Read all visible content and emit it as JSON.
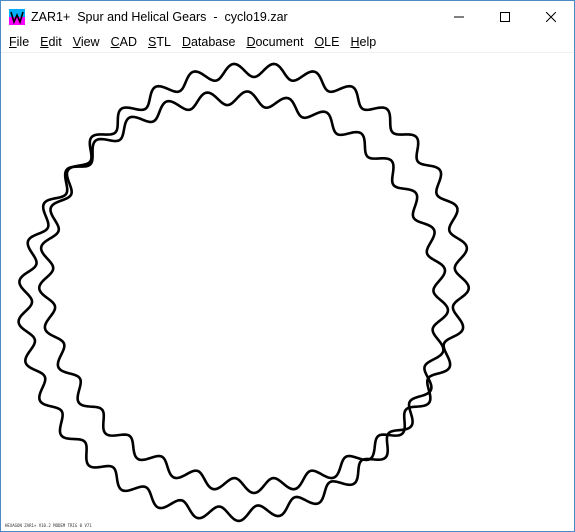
{
  "window": {
    "title": "ZAR1+  Spur and Helical Gears  -  cyclo19.zar",
    "app_icon": "zar-gear-app-icon",
    "controls": {
      "minimize_icon": "minimize-icon",
      "maximize_icon": "maximize-icon",
      "close_icon": "close-icon"
    }
  },
  "menubar": {
    "items": [
      {
        "first": "F",
        "rest": "ile"
      },
      {
        "first": "E",
        "rest": "dit"
      },
      {
        "first": "V",
        "rest": "iew"
      },
      {
        "first": "C",
        "rest": "AD"
      },
      {
        "first": "S",
        "rest": "TL"
      },
      {
        "first": "D",
        "rest": "atabase"
      },
      {
        "first": "D",
        "rest": "ocument"
      },
      {
        "first": "O",
        "rest": "LE"
      },
      {
        "first": "H",
        "rest": "elp"
      }
    ]
  },
  "drawing": {
    "description_colors": {
      "stroke": "#000000",
      "background": "#ffffff"
    },
    "footer_text": "HEXAGON ZAR1+ V10.2 MODEM TRIG 0 V71"
  }
}
